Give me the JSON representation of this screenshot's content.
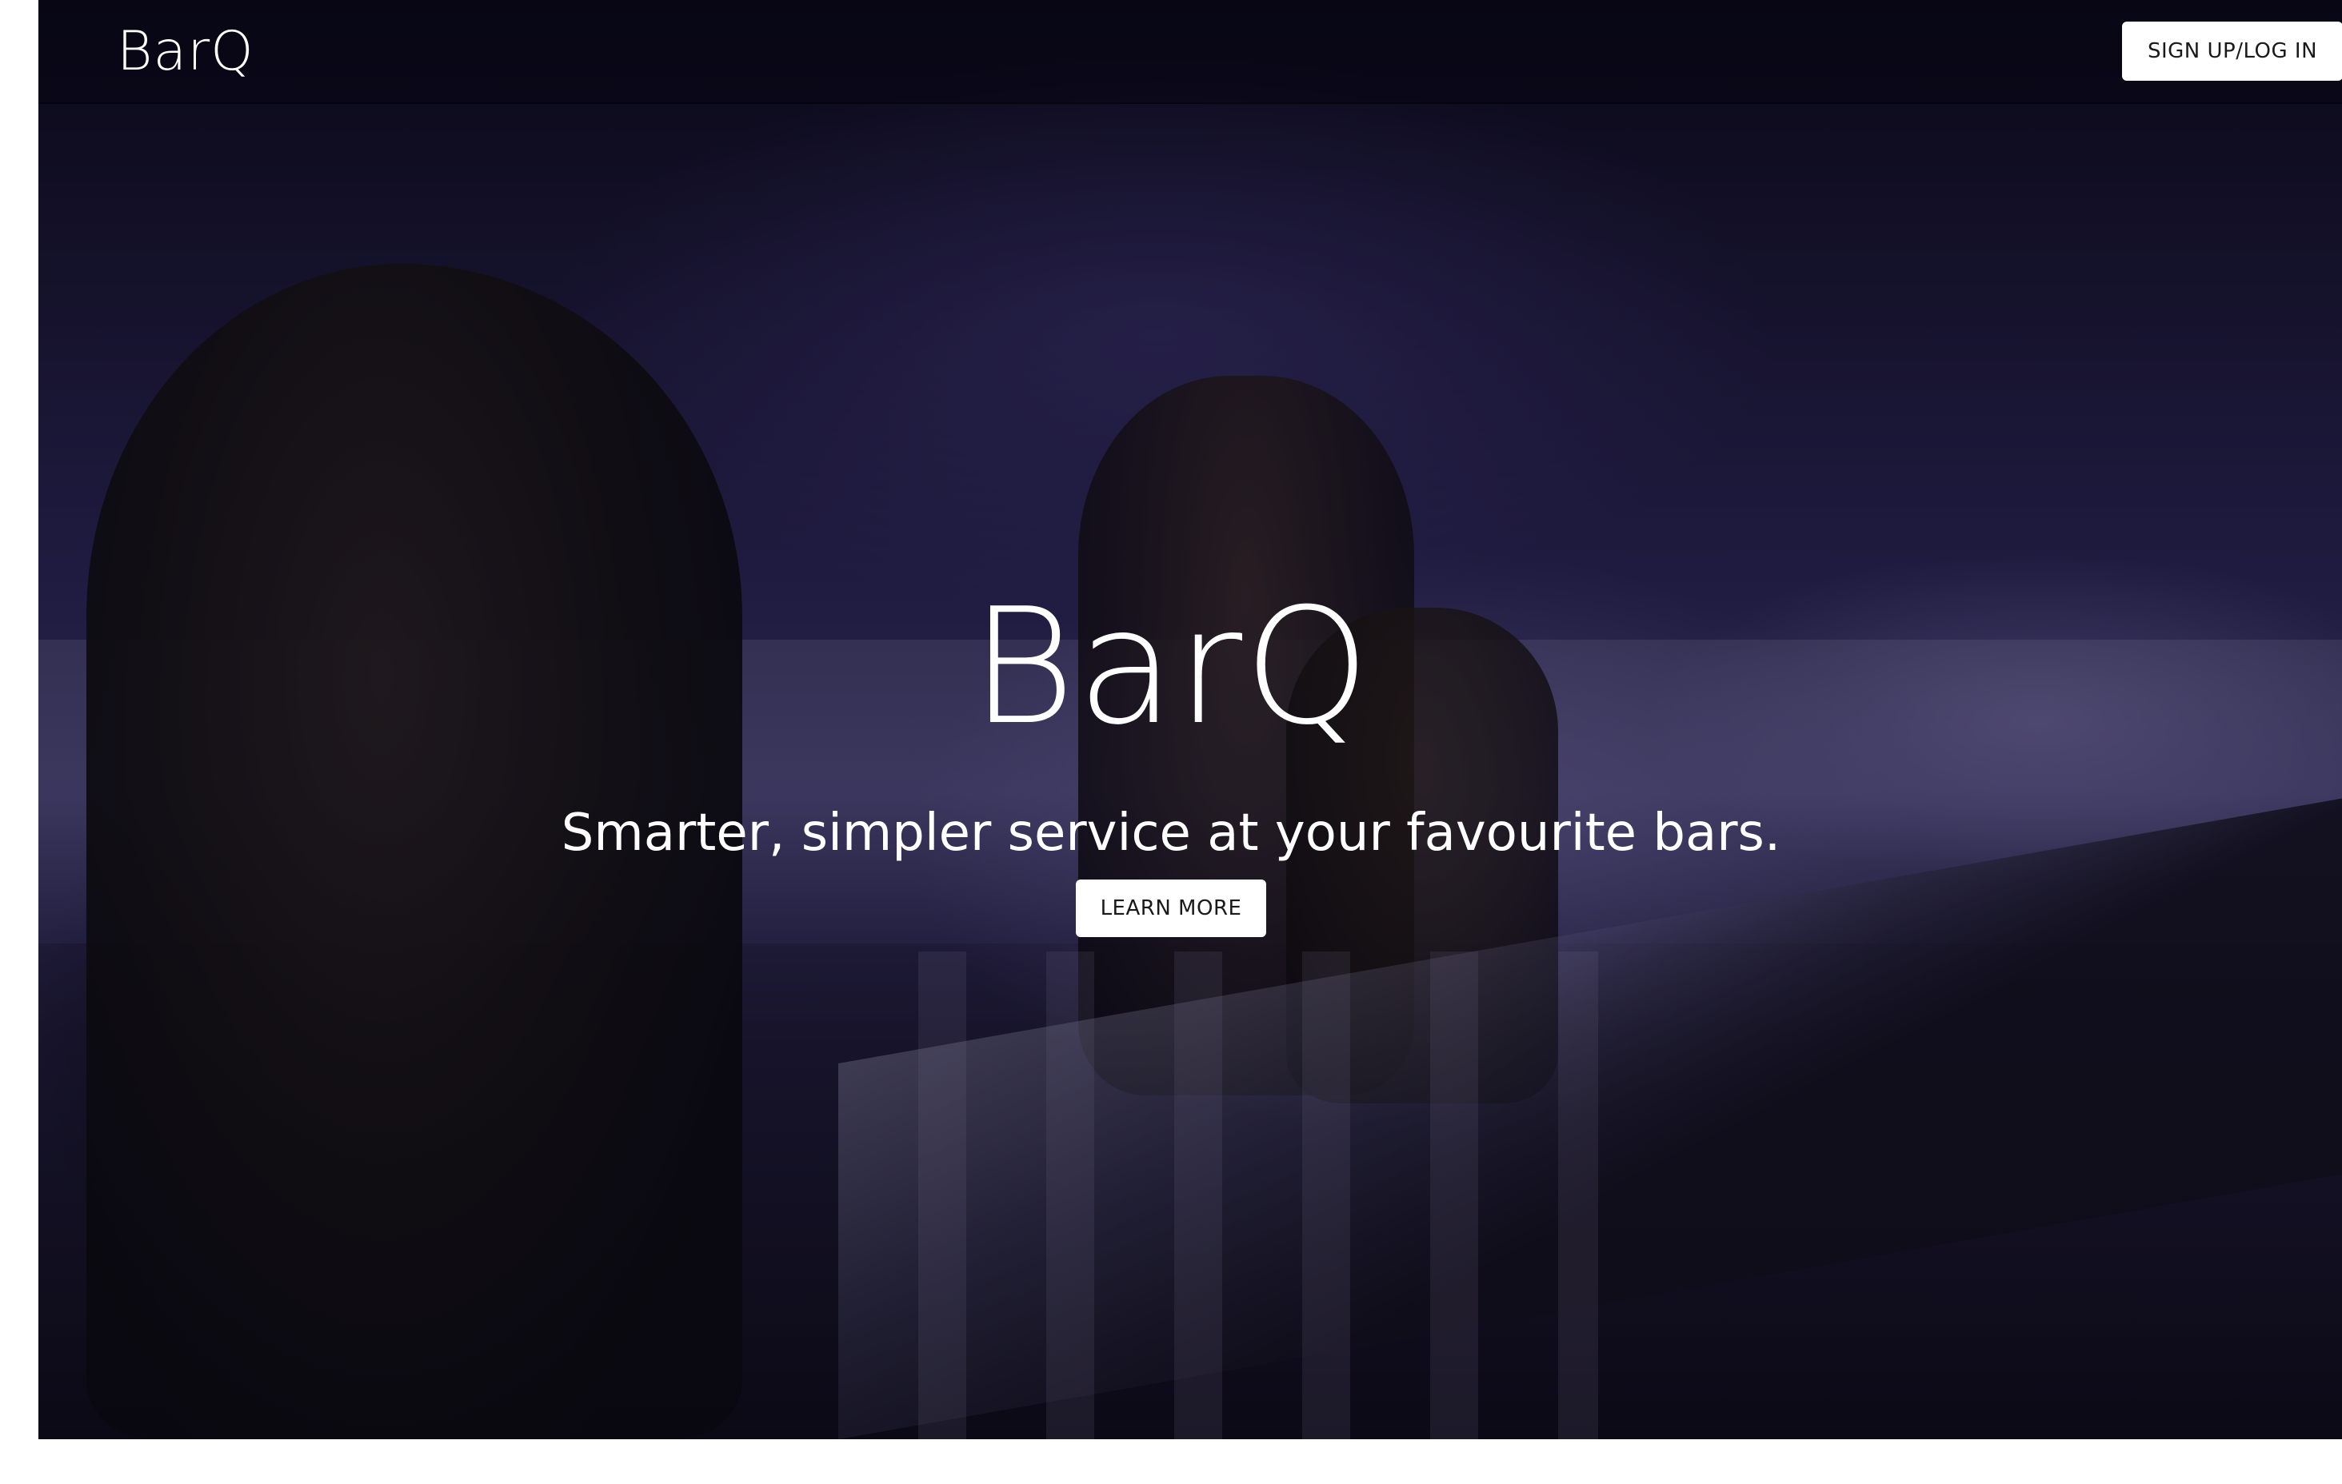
{
  "nav": {
    "brand": "BarQ",
    "signup_label": "SIGN UP/LOG IN"
  },
  "hero": {
    "title": "BarQ",
    "subtitle": "Smarter, simpler service at your favourite bars.",
    "cta_label": "LEARN MORE",
    "background": "bar-crowd-photo"
  },
  "colors": {
    "overlay": "#1e1a3c",
    "button_bg": "#ffffff",
    "text": "#ffffff"
  }
}
